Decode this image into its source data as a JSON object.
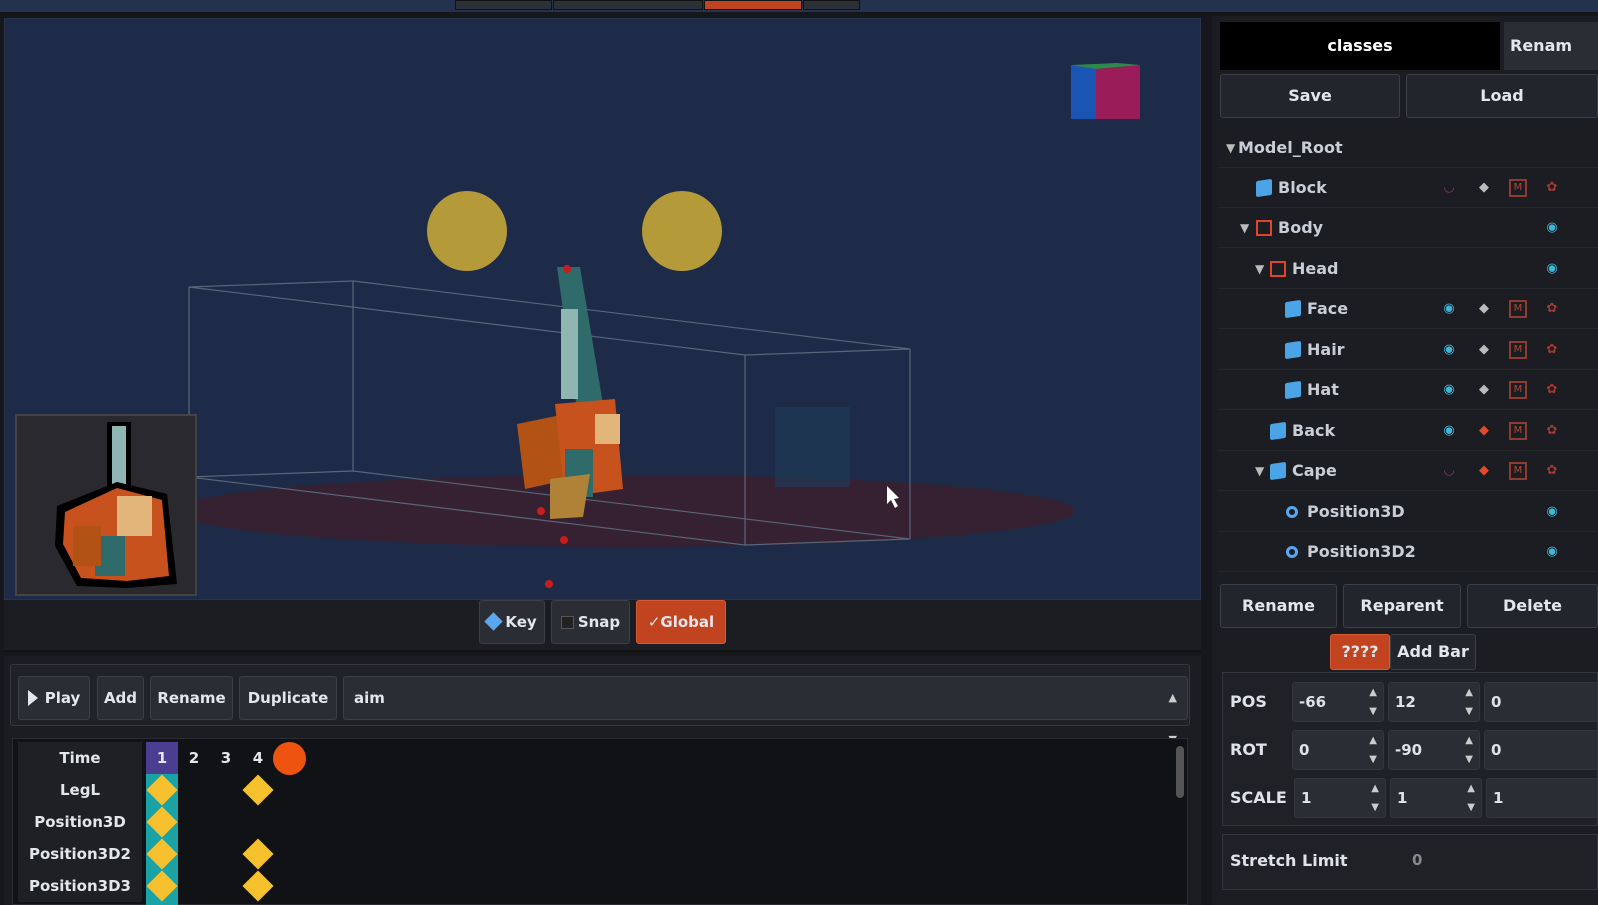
{
  "toolbar": {
    "key_label": "Key",
    "snap_label": "Snap",
    "global_label": "Global",
    "global_check": "✓"
  },
  "animation": {
    "play_label": "Play",
    "add_label": "Add",
    "rename_label": "Rename",
    "duplicate_label": "Duplicate",
    "selected_animation": "aim",
    "time_label": "Time",
    "frames": [
      "1",
      "2",
      "3",
      "4"
    ],
    "tracks": [
      "LegL",
      "Position3D",
      "Position3D2",
      "Position3D3"
    ],
    "current_frame": 1
  },
  "right_panel": {
    "tab_active": "classes",
    "tab_other": "Renam",
    "save_label": "Save",
    "load_label": "Load",
    "tree": [
      {
        "label": "Model_Root"
      },
      {
        "label": "Block"
      },
      {
        "label": "Body"
      },
      {
        "label": "Head"
      },
      {
        "label": "Face"
      },
      {
        "label": "Hair"
      },
      {
        "label": "Hat"
      },
      {
        "label": "Back"
      },
      {
        "label": "Cape"
      },
      {
        "label": "Position3D"
      },
      {
        "label": "Position3D2"
      }
    ],
    "rename_label": "Rename",
    "reparent_label": "Reparent",
    "delete_label": "Delete",
    "mystery_label": "????",
    "addbar_label": "Add Bar",
    "pos_label": "POS",
    "rot_label": "ROT",
    "scale_label": "SCALE",
    "pos": [
      "-66",
      "12",
      "0"
    ],
    "rot": [
      "0",
      "-90",
      "0"
    ],
    "scale": [
      "1",
      "1",
      "1"
    ],
    "stretch_label": "Stretch Limit",
    "stretch_value": "0"
  },
  "colors": {
    "accent": "#c2431f",
    "keyframe": "#f6c12c",
    "current_frame": "#1aa2a5",
    "playhead": "#ee5310"
  },
  "icons": [
    "play-icon",
    "key-icon",
    "eye-icon",
    "lock-icon",
    "mask-icon",
    "paw-icon",
    "cube-icon",
    "bone-icon",
    "point-icon"
  ]
}
